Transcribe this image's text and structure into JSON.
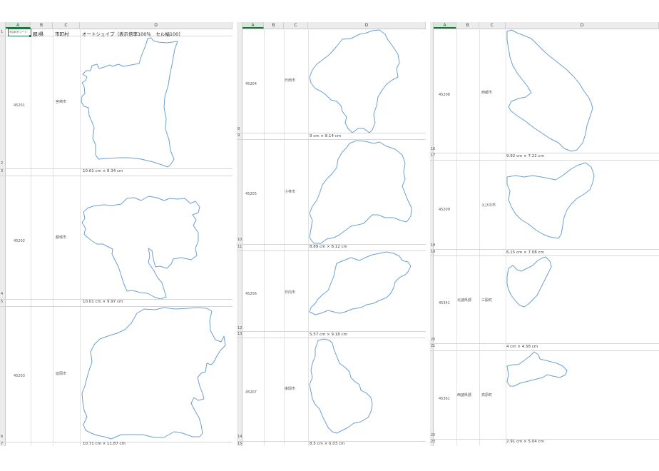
{
  "columns": {
    "a": "A",
    "b": "B",
    "c": "C",
    "d": "D"
  },
  "header_row": {
    "a1": "市区町村コード",
    "b1": "郡/県",
    "c1": "市町村",
    "d1": "オートシェイプ（表示倍率100％　セル幅100）"
  },
  "pane1": {
    "rows": [
      {
        "num": "1"
      },
      {
        "num": "2"
      },
      {
        "num": "3"
      },
      {
        "num": "4"
      },
      {
        "num": "5"
      },
      {
        "num": "6"
      },
      {
        "num": "7"
      }
    ],
    "entries": [
      {
        "code": "45201",
        "name": "宮崎市",
        "dims": "10.61 cm × 8.34 cm"
      },
      {
        "code": "45202",
        "name": "都城市",
        "dims": "10.01 cm × 9.97 cm"
      },
      {
        "code": "45203",
        "name": "延岡市",
        "dims": "10.71 cm × 11.87 cm"
      }
    ]
  },
  "pane2": {
    "rows": [
      {
        "num": "8"
      },
      {
        "num": "9"
      },
      {
        "num": "10"
      },
      {
        "num": "11"
      },
      {
        "num": "12"
      },
      {
        "num": "13"
      },
      {
        "num": "14"
      },
      {
        "num": "15"
      }
    ],
    "entries": [
      {
        "code": "45204",
        "name": "日南市",
        "dims": "9 cm × 8.14 cm"
      },
      {
        "code": "45205",
        "name": "小林市",
        "dims": "8.89 cm × 8.12 cm"
      },
      {
        "code": "45206",
        "name": "日向市",
        "dims": "5.57 cm × 9.18 cm"
      },
      {
        "code": "45207",
        "name": "串間市",
        "dims": "8.5 cm × 6.03 cm"
      }
    ]
  },
  "pane3": {
    "rows": [
      {
        "num": "16"
      },
      {
        "num": "17"
      },
      {
        "num": "18"
      },
      {
        "num": "19"
      },
      {
        "num": "20"
      },
      {
        "num": "21"
      },
      {
        "num": "22"
      },
      {
        "num": "23"
      }
    ],
    "entries": [
      {
        "code": "45208",
        "district": "",
        "name": "西都市",
        "dims": "9.92 cm × 7.22 cm"
      },
      {
        "code": "45209",
        "district": "",
        "name": "えびの市",
        "dims": "6.15 cm × 7.08 cm"
      },
      {
        "code": "45341",
        "district": "北諸県郡",
        "name": "三股町",
        "dims": "4 cm × 4.58 cm"
      },
      {
        "code": "45361",
        "district": "西諸県郡",
        "name": "高原町",
        "dims": "2.91 cm × 5.04 cm"
      }
    ]
  },
  "colors": {
    "outline": "#6a9fd4",
    "grid": "#d6d6d6",
    "header_bg": "#ececec",
    "select": "#217346"
  }
}
